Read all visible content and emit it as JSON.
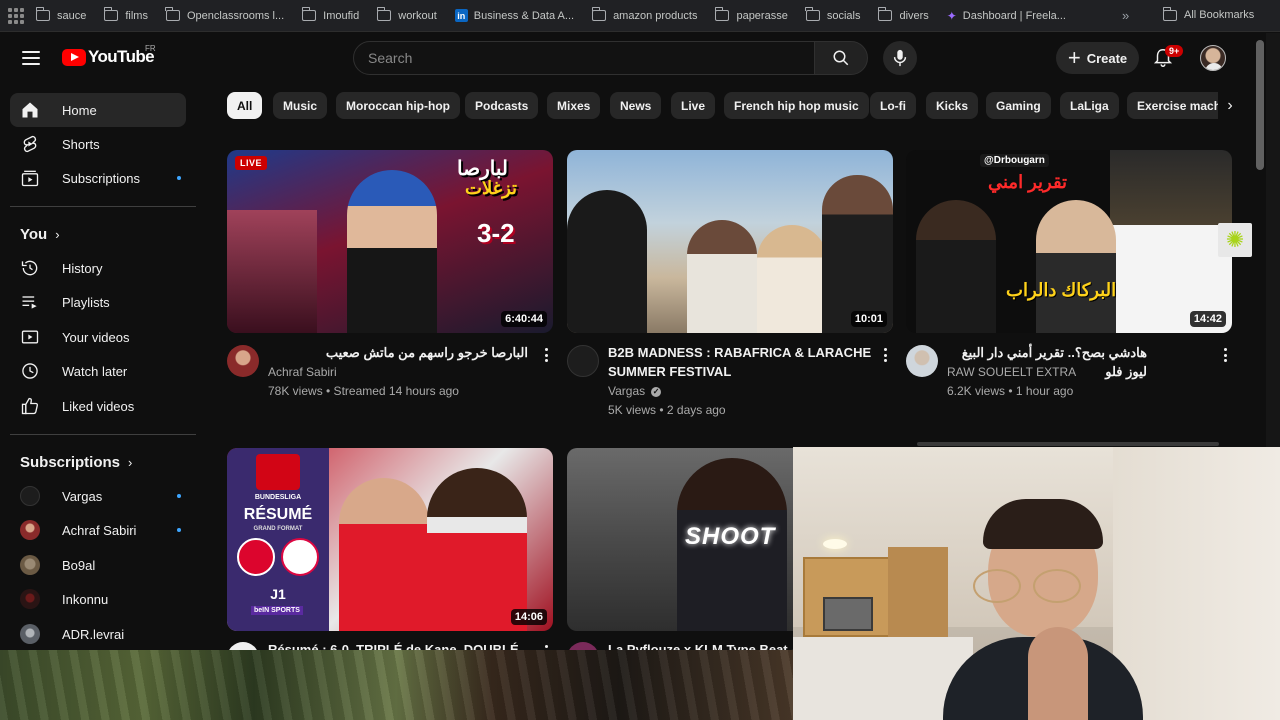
{
  "bookmarks": {
    "items": [
      "sauce",
      "films",
      "Openclassrooms l...",
      "Imoufid",
      "workout",
      "Business & Data A...",
      "amazon products",
      "paperasse",
      "socials",
      "divers",
      "Dashboard | Freela..."
    ],
    "more": "»",
    "all": "All Bookmarks"
  },
  "masthead": {
    "logo_text": "YouTube",
    "country": "FR",
    "search_placeholder": "Search",
    "create_label": "Create",
    "notif_count": "9+"
  },
  "sidebar": {
    "main": [
      {
        "label": "Home",
        "icon": "home-icon"
      },
      {
        "label": "Shorts",
        "icon": "shorts-icon"
      },
      {
        "label": "Subscriptions",
        "icon": "subscriptions-icon"
      }
    ],
    "you_heading": "You",
    "you": [
      {
        "label": "History",
        "icon": "history-icon"
      },
      {
        "label": "Playlists",
        "icon": "playlists-icon"
      },
      {
        "label": "Your videos",
        "icon": "your-videos-icon"
      },
      {
        "label": "Watch later",
        "icon": "watch-later-icon"
      },
      {
        "label": "Liked videos",
        "icon": "liked-videos-icon"
      }
    ],
    "subs_heading": "Subscriptions",
    "subs": [
      {
        "label": "Vargas",
        "color": "#1d1d1d"
      },
      {
        "label": "Achraf Sabiri",
        "color": "#8a2a2a"
      },
      {
        "label": "Bo9al",
        "color": "#6b5a44"
      },
      {
        "label": "Inkonnu",
        "color": "#2a1414"
      },
      {
        "label": "ADR.levrai",
        "color": "#5a5f66"
      }
    ]
  },
  "chips": [
    "All",
    "Music",
    "Moroccan hip-hop",
    "Podcasts",
    "Mixes",
    "News",
    "Live",
    "French hip hop music",
    "Lo-fi",
    "Kicks",
    "Gaming",
    "LaLiga",
    "Exercise mach"
  ],
  "videos": [
    {
      "title": "البارصا خرجو راسهم من ماتش صعيب",
      "channel": "Achraf Sabiri",
      "meta": "78K views • Streamed 14 hours ago",
      "duration": "6:40:44",
      "live": "LIVE",
      "thumb_text": "تزغلات",
      "thumb_text2": "لبارصا",
      "score": "3-2"
    },
    {
      "title": "B2B MADNESS : RABAFRICA & LARACHE SUMMER FESTIVAL",
      "channel": "Vargas",
      "meta": "5K views • 2 days ago",
      "duration": "10:01"
    },
    {
      "title": "هادشي بصح؟.. تقرير أمني دار البيغ ليوز فلو",
      "channel": "RAW SOUEELT EXTRA",
      "meta": "6.2K views • 1 hour ago",
      "duration": "14:42",
      "thumb_handle": "@Drbougarn",
      "thumb_text": "تقرير امني",
      "thumb_text2": "البركاك دالراب"
    },
    {
      "title": "Résumé : 6-0, TRIPLÉ de Kane, DOUBLÉ",
      "duration": "14:06",
      "league": "BUNDESLIGA",
      "resume": "RÉSUMÉ",
      "resume_sub": "GRAND FORMAT",
      "j": "J1",
      "network": "beIN SPORTS"
    },
    {
      "title": "La Pyflouze x KLM Type Beat -",
      "thumb_text": "SHOOT"
    }
  ]
}
